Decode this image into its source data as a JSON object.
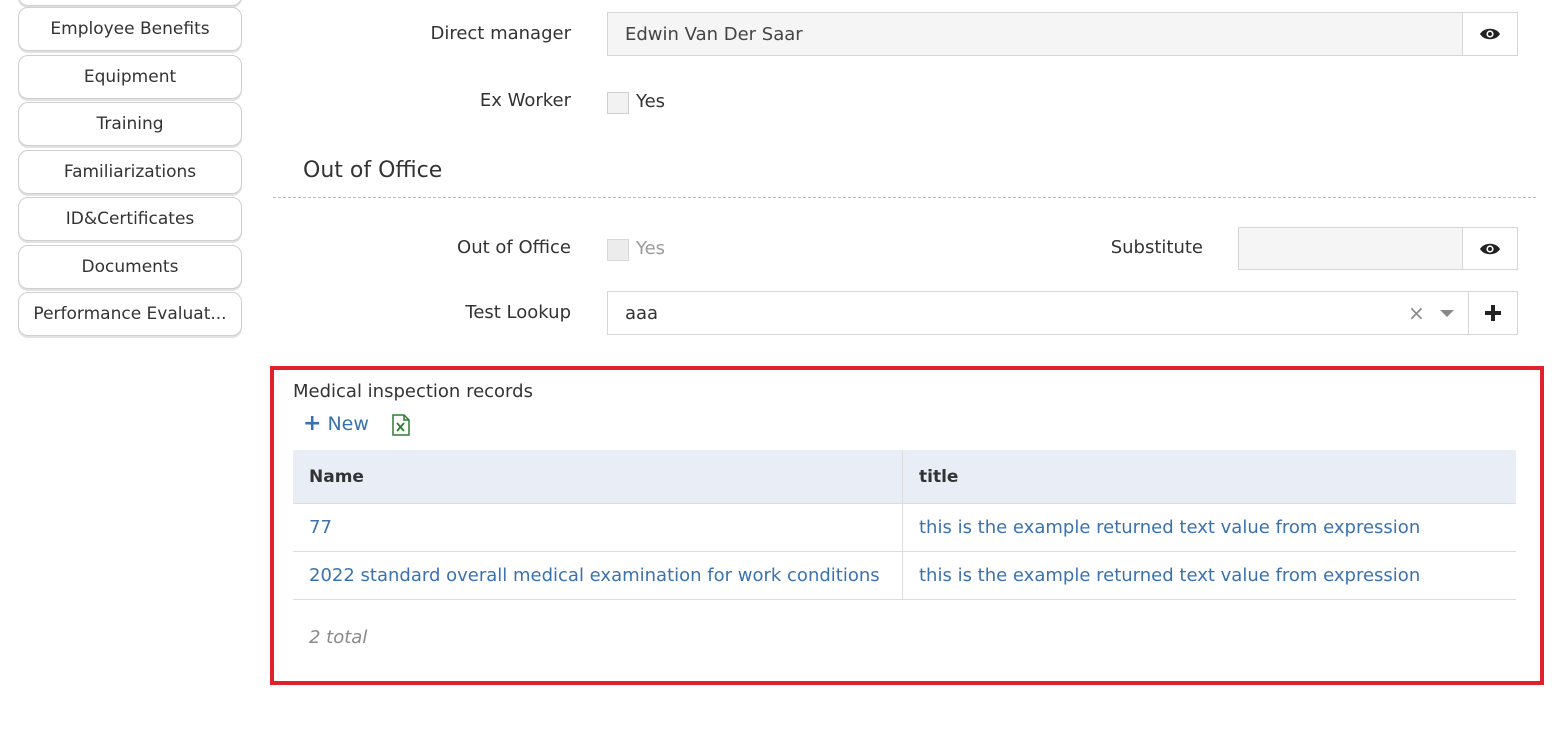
{
  "sidebar": {
    "items": [
      {
        "label": "Employee Benefits"
      },
      {
        "label": "Equipment"
      },
      {
        "label": "Training"
      },
      {
        "label": "Familiarizations"
      },
      {
        "label": "ID&Certificates"
      },
      {
        "label": "Documents"
      },
      {
        "label": "Performance Evaluat..."
      }
    ]
  },
  "form": {
    "direct_manager": {
      "label": "Direct manager",
      "value": "Edwin Van Der Saar"
    },
    "ex_worker": {
      "label": "Ex Worker",
      "option": "Yes",
      "checked": false
    },
    "section_title": "Out of Office",
    "out_of_office": {
      "label": "Out of Office",
      "option": "Yes",
      "checked": false,
      "disabled": true
    },
    "substitute": {
      "label": "Substitute",
      "value": ""
    },
    "test_lookup": {
      "label": "Test Lookup",
      "value": "aaa",
      "clear_glyph": "×"
    }
  },
  "panel": {
    "title": "Medical inspection records",
    "new_label": "New",
    "new_glyph": "+",
    "columns": [
      "Name",
      "title"
    ],
    "rows": [
      [
        "77",
        "this is the example returned text value from expression"
      ],
      [
        "2022 standard overall medical examination for work conditions",
        "this is the example returned text value from expression"
      ]
    ],
    "total": "2 total"
  },
  "colors": {
    "accent": "#3a72b0",
    "highlight": "#e0202b",
    "header_bg": "#e9edf6",
    "excel": "#2e7d32"
  },
  "icons": {
    "view": "eye-icon",
    "add": "plus-icon",
    "export": "excel-icon",
    "clear": "close-icon",
    "dropdown": "chevron-down-icon"
  }
}
